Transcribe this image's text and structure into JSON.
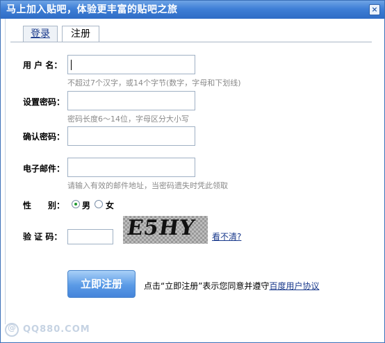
{
  "window": {
    "title": "马上加入贴吧，体验更丰富的贴吧之旅",
    "close_symbol": "×"
  },
  "tabs": {
    "login": "登录",
    "register": "注册"
  },
  "form": {
    "username_label": "用 户 名：",
    "username_hint": "不超过7个汉字，或14个字节(数字，字母和下划线)",
    "password_label": "设置密码：",
    "password_hint": "密码长度6～14位，字母区分大小写",
    "confirm_label": "确认密码：",
    "email_label": "电子邮件：",
    "email_hint": "请输入有效的邮件地址，当密码遗失时凭此领取",
    "gender_label": "性　　别：",
    "gender_male": "男",
    "gender_female": "女",
    "gender_selected": "男",
    "captcha_label": "验 证 码：",
    "captcha_image_text": "E5HY",
    "captcha_refresh": "看不清?"
  },
  "actions": {
    "submit": "立即注册",
    "agree_prefix": "点击“立即注册”表示您同意并遵守",
    "agree_link": "百度用户协议"
  },
  "watermark": {
    "text": "QQ880.COM",
    "symbol": "@"
  },
  "colors": {
    "titlebar": "#3f7fd6",
    "link": "#1a3a8c",
    "hint": "#8a8a8a"
  }
}
